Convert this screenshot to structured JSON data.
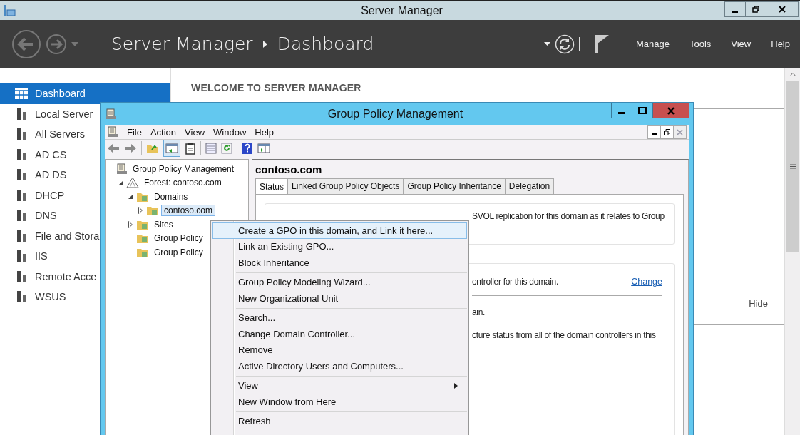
{
  "server_manager": {
    "title": "Server Manager",
    "breadcrumb": [
      "Server Manager",
      "Dashboard"
    ],
    "menus": [
      "Manage",
      "Tools",
      "View",
      "Help"
    ],
    "sidebar": [
      {
        "label": "Dashboard",
        "selected": true
      },
      {
        "label": "Local Server",
        "selected": false
      },
      {
        "label": "All Servers",
        "selected": false
      },
      {
        "label": "AD CS",
        "selected": false
      },
      {
        "label": "AD DS",
        "selected": false
      },
      {
        "label": "DHCP",
        "selected": false
      },
      {
        "label": "DNS",
        "selected": false
      },
      {
        "label": "File and Stora",
        "selected": false
      },
      {
        "label": "IIS",
        "selected": false
      },
      {
        "label": "Remote Acce",
        "selected": false
      },
      {
        "label": "WSUS",
        "selected": false
      }
    ],
    "welcome": "WELCOME TO SERVER MANAGER",
    "hide": "Hide"
  },
  "gpm": {
    "title": "Group Policy Management",
    "menu": [
      "File",
      "Action",
      "View",
      "Window",
      "Help"
    ],
    "tree": [
      {
        "label": "Group Policy Management",
        "selected": false,
        "children": [
          {
            "label": "Forest: contoso.com",
            "selected": false,
            "expanded": true,
            "children": [
              {
                "label": "Domains",
                "selected": false,
                "expanded": true,
                "children": [
                  {
                    "label": "contoso.com",
                    "selected": true,
                    "expanded": false
                  }
                ]
              },
              {
                "label": "Sites",
                "selected": false,
                "expanded": false
              },
              {
                "label": "Group Policy",
                "selected": false
              },
              {
                "label": "Group Policy",
                "selected": false
              }
            ]
          }
        ]
      }
    ],
    "header": "contoso.com",
    "tabs": [
      {
        "label": "Status",
        "selected": true
      },
      {
        "label": "Linked Group Policy Objects",
        "selected": false
      },
      {
        "label": "Group Policy Inheritance",
        "selected": false
      },
      {
        "label": "Delegation",
        "selected": false
      }
    ],
    "box_1": [
      "SVOL replication for this domain as it relates to Group"
    ],
    "box_2_line": "ontroller for this domain.",
    "change_link": "Change",
    "box_2_rest": [
      "ain.",
      "cture status from all of the domain controllers in this"
    ]
  },
  "context_menu": [
    [
      {
        "label": "Create a GPO in this domain, and Link it here...",
        "selected": true,
        "submenu": false
      },
      {
        "label": "Link an Existing GPO...",
        "selected": false,
        "submenu": false
      },
      {
        "label": "Block Inheritance",
        "selected": false,
        "submenu": false
      }
    ],
    [
      {
        "label": "Group Policy Modeling Wizard...",
        "selected": false,
        "submenu": false
      },
      {
        "label": "New Organizational Unit",
        "selected": false,
        "submenu": false
      }
    ],
    [
      {
        "label": "Search...",
        "selected": false,
        "submenu": false
      },
      {
        "label": "Change Domain Controller...",
        "selected": false,
        "submenu": false
      },
      {
        "label": "Remove",
        "selected": false,
        "submenu": false
      },
      {
        "label": "Active Directory Users and Computers...",
        "selected": false,
        "submenu": false
      }
    ],
    [
      {
        "label": "View",
        "selected": false,
        "submenu": true
      },
      {
        "label": "New Window from Here",
        "selected": false,
        "submenu": false
      }
    ],
    [
      {
        "label": "Refresh",
        "selected": false,
        "submenu": false
      }
    ]
  ]
}
